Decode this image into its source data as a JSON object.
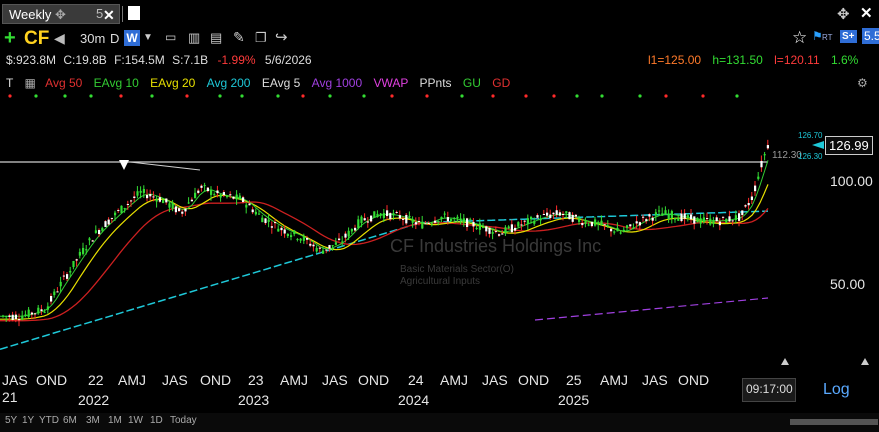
{
  "tabs": {
    "active": "Weekly",
    "second": "5"
  },
  "toolbar": {
    "symbol": "CF",
    "interval": "30m",
    "d": "D",
    "w": "W",
    "rt": "RT",
    "s_badge": "S+",
    "level_badge": "5.5"
  },
  "stats": {
    "mcap": "$:923.8M",
    "cap": "C:19.8B",
    "float": "F:154.5M",
    "shares": "S:7.1B",
    "change": "-1.99%",
    "date": "5/6/2026",
    "l1": "l1=125.00",
    "h": "h=131.50",
    "l": "l=120.11",
    "pct": "1.6%"
  },
  "indicators": [
    {
      "label": "T",
      "color": "#dddddd"
    },
    {
      "label": "Avg 50",
      "color": "#e03030"
    },
    {
      "label": "EAvg 10",
      "color": "#33cc33"
    },
    {
      "label": "EAvg 20",
      "color": "#e8e000"
    },
    {
      "label": "Avg 200",
      "color": "#1ec8d8"
    },
    {
      "label": "EAvg 5",
      "color": "#dddddd"
    },
    {
      "label": "Avg 1000",
      "color": "#a040e0"
    },
    {
      "label": "VWAP",
      "color": "#e040e0"
    },
    {
      "label": "PPnts",
      "color": "#dddddd"
    },
    {
      "label": "GU",
      "color": "#33cc33"
    },
    {
      "label": "GD",
      "color": "#e03030"
    }
  ],
  "watermark": {
    "name": "CF Industries Holdings Inc",
    "sector": "Basic Materials Sector(O)",
    "industry": "Agricultural Inputs"
  },
  "price_axis": {
    "last": "126.99",
    "p100": "100.00",
    "p50": "50.00",
    "hline": "112.30",
    "hi_small": "126.70",
    "lo_small": "126.30"
  },
  "x_axis": {
    "ticks": [
      "JAS",
      "OND",
      "22",
      "AMJ",
      "JAS",
      "OND",
      "23",
      "AMJ",
      "JAS",
      "OND",
      "24",
      "AMJ",
      "JAS",
      "OND",
      "25",
      "AMJ",
      "JAS",
      "OND"
    ],
    "years": [
      "2022",
      "2023",
      "2024",
      "2025"
    ],
    "partial_year": "21"
  },
  "time": "09:17:00",
  "log_label": "Log",
  "ranges": [
    "5Y",
    "1Y",
    "YTD",
    "6M",
    "3M",
    "1M",
    "1W",
    "1D",
    "Today"
  ],
  "chart_data": {
    "type": "candlestick",
    "x_range": [
      "2021-07",
      "2026-05"
    ],
    "y_ticks": [
      50,
      100
    ],
    "scale": "log",
    "last": 126.99,
    "reference_line": 112.3
  }
}
